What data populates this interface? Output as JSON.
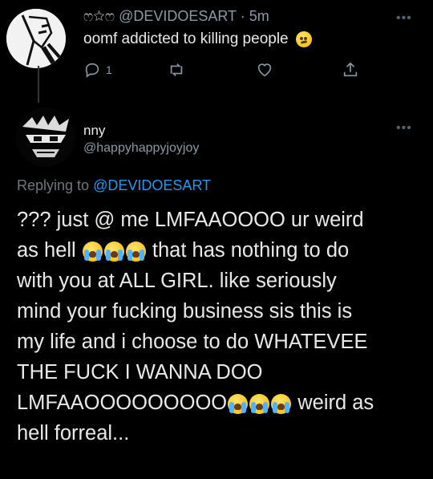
{
  "tweet1": {
    "handle_deco": "ෆ☆ෆ",
    "handle": "@DEVIDOESART",
    "time": "· 5m",
    "text": "oomf addicted to killing people",
    "emoji": "confused-face",
    "reply_count": "1"
  },
  "tweet2": {
    "name": "nny",
    "handle": "@happyhappyjoyjoy",
    "replying_prefix": "Replying to",
    "replying_to": "@DEVIDOESART",
    "lines": [
      "??? just @ me LMFAAOOOO ur weird",
      "as hell",
      "that has nothing to do",
      "with you at ALL GIRL. like seriously",
      "mind your fucking business sis this is",
      "my life and i choose to do WHATEVEE",
      "THE FUCK I WANNA DOO",
      "LMFAAOOOOOOOOO",
      "weird as",
      "hell forreal..."
    ],
    "emoji": "loudly-crying-face"
  },
  "colors": {
    "background": "#000000",
    "text": "#e7e9ea",
    "muted": "#8b98a5",
    "link": "#1d9bf0"
  }
}
